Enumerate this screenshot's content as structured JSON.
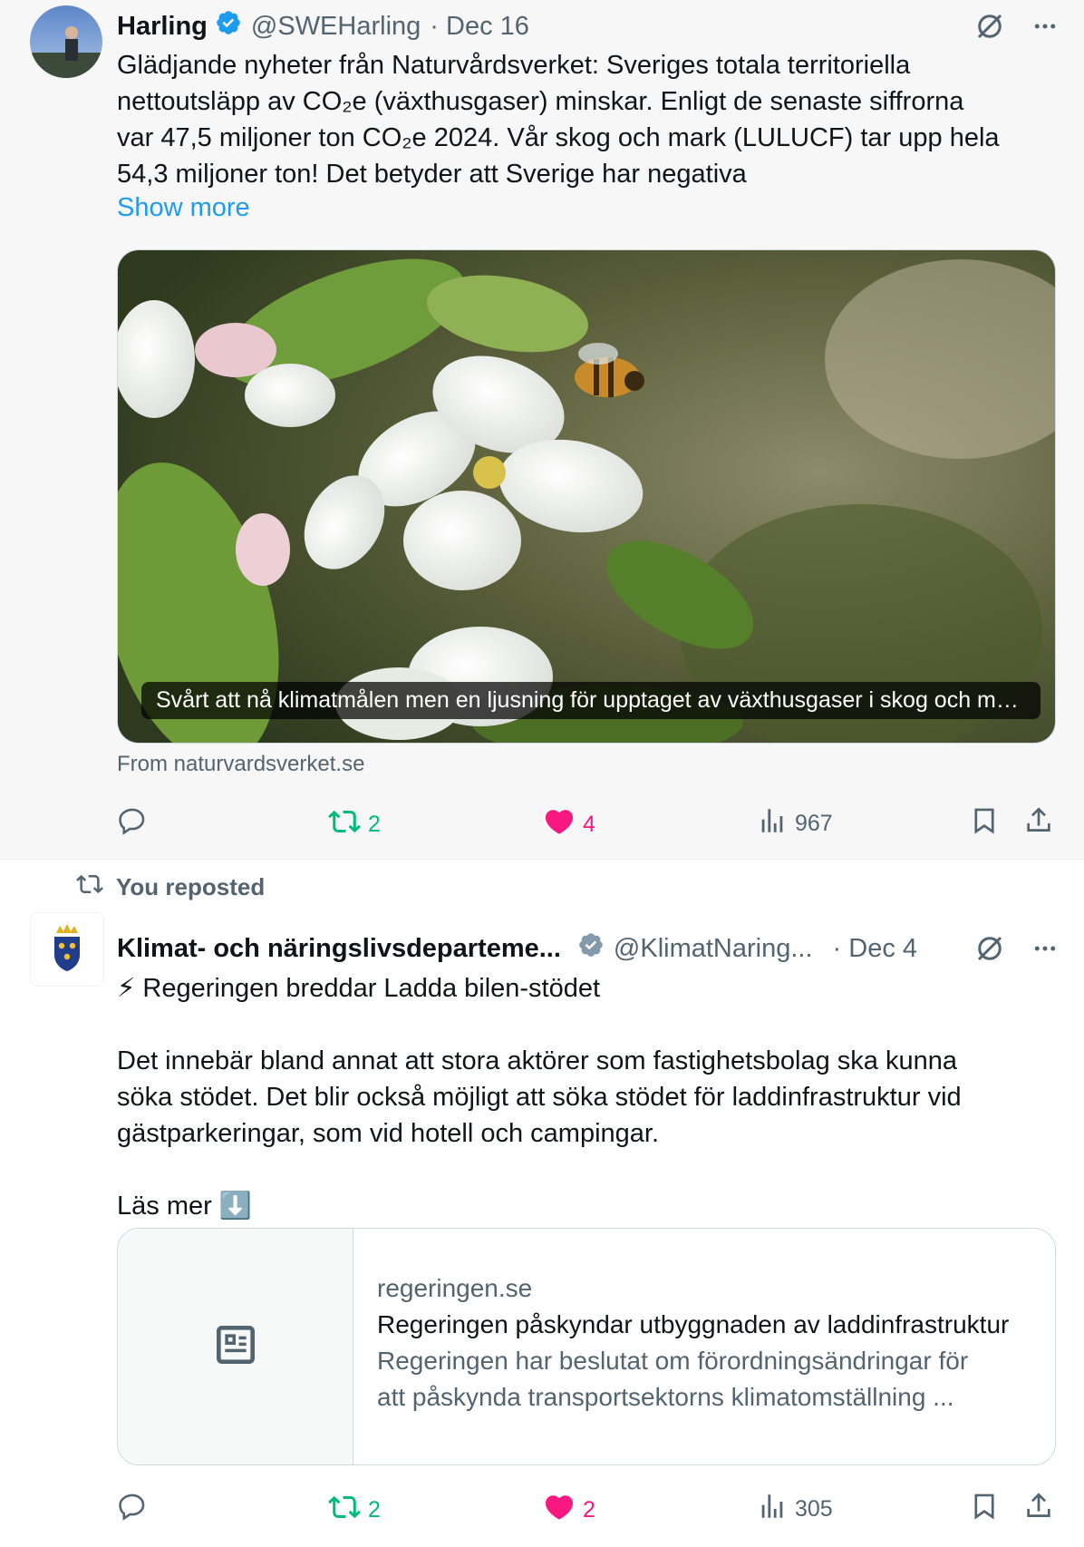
{
  "tweet1": {
    "author_name": "Harling",
    "author_handle": "@SWEHarling",
    "date": "· Dec 16",
    "text_lines": [
      "Glädjande nyheter från Naturvårdsverket: Sveriges totala territoriella",
      "nettoutsläpp av CO₂e (växthusgaser) minskar. Enligt de senaste siffrorna",
      "var 47,5 miljoner ton CO₂e 2024. Vår skog och mark (LULUCF) tar upp hela",
      "54,3 miljoner ton!  Det betyder att Sverige har negativa"
    ],
    "show_more": "Show more",
    "media_caption": "Svårt att nå klimatmålen men en ljusning för upptaget av växthusgaser i skog och mark",
    "media_source": "From naturvardsverket.se",
    "replies": "",
    "reposts": "2",
    "likes": "4",
    "views": "967"
  },
  "tweet2": {
    "repost_label": "You reposted",
    "author_name": "Klimat- och näringslivsdeparteme...",
    "author_handle": "@KlimatNaring...",
    "date": "· Dec 4",
    "text_line1": "⚡ Regeringen breddar Ladda bilen-stödet",
    "text_para2_lines": [
      "Det innebär bland annat att stora aktörer som fastighetsbolag ska kunna",
      "söka stödet. Det blir också möjligt att söka stödet för laddinfrastruktur vid",
      "gästparkeringar, som vid hotell och campingar."
    ],
    "text_read_more": "Läs mer ⬇️",
    "card_domain": "regeringen.se",
    "card_title": "Regeringen påskyndar utbyggnaden av laddinfrastruktur",
    "card_desc_lines": [
      "Regeringen har beslutat om förordningsändringar för",
      "att påskynda transportsektorns klimatomställning ..."
    ],
    "replies": "",
    "reposts": "2",
    "likes": "2",
    "views": "305"
  },
  "colors": {
    "link": "#1d9bf0",
    "verified": "#1d9bf0",
    "repost": "#00ba7c",
    "like": "#f91880",
    "secondary_text": "#536471"
  },
  "icons": [
    "verified-badge-icon",
    "grok-icon",
    "more-icon",
    "reply-icon",
    "repost-icon",
    "heart-icon",
    "views-icon",
    "bookmark-icon",
    "share-icon",
    "article-icon"
  ]
}
